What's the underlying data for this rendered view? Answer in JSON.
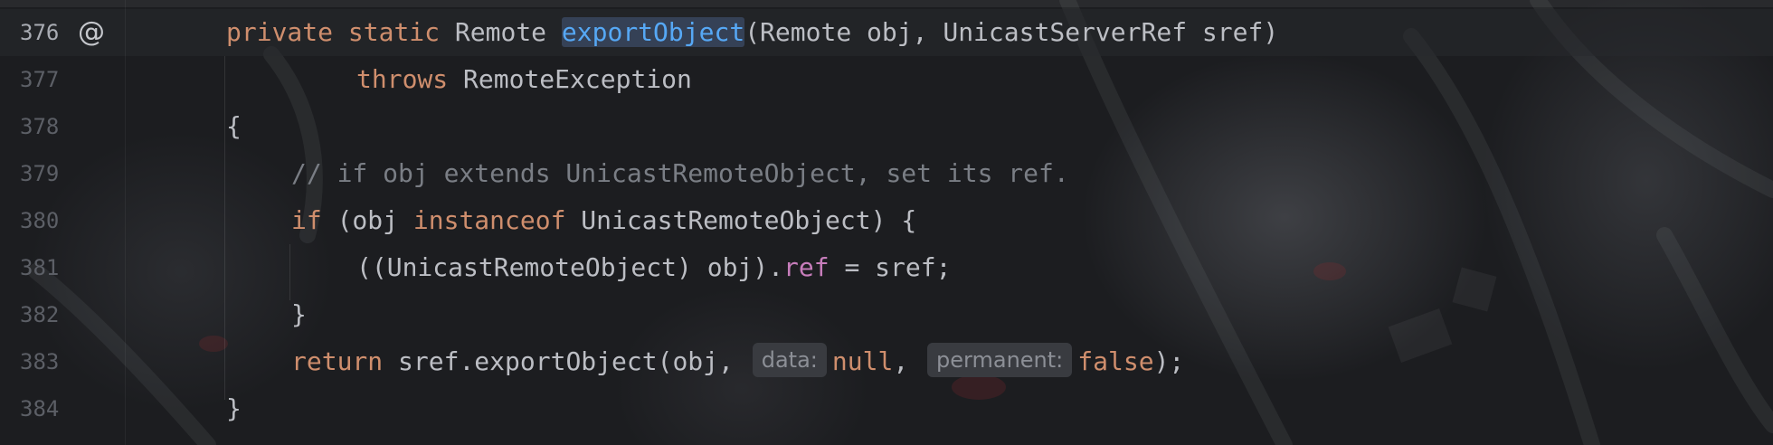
{
  "editor": {
    "lines": [
      {
        "number": "376",
        "active": true,
        "gutter_icon": "@",
        "indent": 1,
        "tokens": [
          {
            "text": "private",
            "cls": "kw"
          },
          {
            "text": " ",
            "cls": "ty"
          },
          {
            "text": "static",
            "cls": "kw"
          },
          {
            "text": " Remote ",
            "cls": "ty"
          },
          {
            "text": "exportObject",
            "cls": "fn-decl"
          },
          {
            "text": "(Remote obj, UnicastServerRef sref)",
            "cls": "ty"
          }
        ]
      },
      {
        "number": "377",
        "indent": 3,
        "tokens": [
          {
            "text": "throws",
            "cls": "kw"
          },
          {
            "text": " RemoteException",
            "cls": "ty"
          }
        ]
      },
      {
        "number": "378",
        "indent": 1,
        "tokens": [
          {
            "text": "{",
            "cls": "ty"
          }
        ]
      },
      {
        "number": "379",
        "indent": 2,
        "tokens": [
          {
            "text": "// if obj extends UnicastRemoteObject, set its ref.",
            "cls": "cmt"
          }
        ]
      },
      {
        "number": "380",
        "indent": 2,
        "tokens": [
          {
            "text": "if",
            "cls": "kw"
          },
          {
            "text": " (obj ",
            "cls": "ty"
          },
          {
            "text": "instanceof",
            "cls": "kw"
          },
          {
            "text": " UnicastRemoteObject) {",
            "cls": "ty"
          }
        ]
      },
      {
        "number": "381",
        "indent": 3,
        "tokens": [
          {
            "text": "((UnicastRemoteObject) obj).",
            "cls": "ty"
          },
          {
            "text": "ref",
            "cls": "field"
          },
          {
            "text": " = sref;",
            "cls": "ty"
          }
        ]
      },
      {
        "number": "382",
        "indent": 2,
        "tokens": [
          {
            "text": "}",
            "cls": "ty"
          }
        ]
      },
      {
        "number": "383",
        "indent": 2,
        "tokens": [
          {
            "text": "return",
            "cls": "kw"
          },
          {
            "text": " sref.exportObject(obj, ",
            "cls": "ty"
          },
          {
            "text": "data:",
            "cls": "hint"
          },
          {
            "text": "null",
            "cls": "kw"
          },
          {
            "text": ", ",
            "cls": "ty"
          },
          {
            "text": "permanent:",
            "cls": "hint"
          },
          {
            "text": "false",
            "cls": "kw"
          },
          {
            "text": ");",
            "cls": "ty"
          }
        ]
      },
      {
        "number": "384",
        "indent": 1,
        "tokens": [
          {
            "text": "}",
            "cls": "ty"
          }
        ]
      }
    ]
  },
  "colors": {
    "background": "#1c1d20",
    "keyword": "#cf8e6d",
    "declaration": "#56a8f5",
    "comment": "#7a7e85",
    "field": "#c77dbb",
    "text": "#bcbec4",
    "line_number": "#5c5f66",
    "inlay_hint_bg": "#393b40"
  }
}
